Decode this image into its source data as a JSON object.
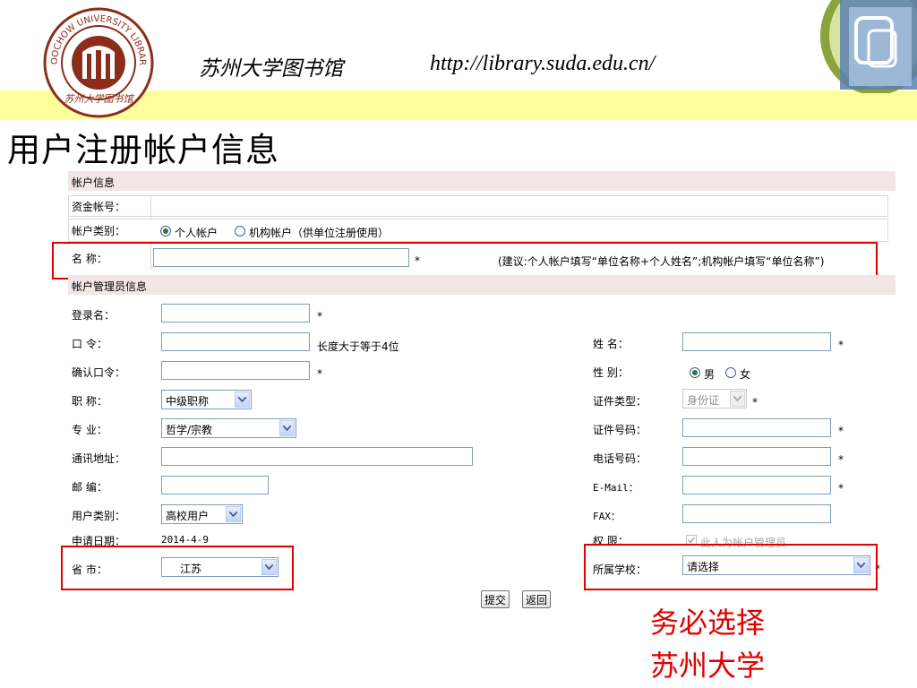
{
  "header": {
    "library_name": "苏州大学图书馆",
    "library_url": "http://library.suda.edu.cn/",
    "logo_text_top": "SOOCHOW UNIVERSITY LIBRARY",
    "logo_text_bottom": "苏州大学图书馆"
  },
  "slide_title": "用户注册帐户信息",
  "account_section": {
    "header": "帐户信息",
    "fund_account_label": "资金帐号：",
    "account_type_label": "帐户类别：",
    "account_type_options": [
      "个人帐户",
      "机构帐户（供单位注册使用）"
    ],
    "account_type_selected": "个人帐户",
    "name_label": "名 称：",
    "name_value": "",
    "name_hint": "(建议:个人帐户填写“单位名称+个人姓名”;机构帐户填写“单位名称”)"
  },
  "admin_section": {
    "header": "帐户管理员信息",
    "login_label": "登录名：",
    "password_label": "口 令：",
    "password_hint": "长度大于等于4位",
    "confirm_label": "确认口令：",
    "title_label": "职 称：",
    "title_value": "中级职称",
    "major_label": "专 业：",
    "major_value": "哲学/宗教",
    "address_label": "通讯地址：",
    "zip_label": "邮 编：",
    "user_type_label": "用户类别：",
    "user_type_value": "高校用户",
    "apply_date_label": "申请日期：",
    "apply_date_value": "2014-4-9",
    "province_label": "省 市：",
    "province_value": "江苏",
    "surname_label": "姓 名：",
    "gender_label": "性 别：",
    "gender_options": [
      "男",
      "女"
    ],
    "gender_selected": "男",
    "id_type_label": "证件类型：",
    "id_type_value": "身份证",
    "id_number_label": "证件号码：",
    "phone_label": "电话号码：",
    "email_label": "E-Mail：",
    "fax_label": "FAX：",
    "permission_label": "权 限：",
    "permission_checkbox": "此人为帐户管理员",
    "school_label": "所属学校：",
    "school_value": "请选择",
    "required_mark": "*"
  },
  "buttons": {
    "submit": "提交",
    "back": "返回"
  },
  "annotation": {
    "line1": "务必选择",
    "line2": "苏州大学"
  },
  "colors": {
    "highlight_red": "#e00000",
    "section_bg": "#f3e6e6",
    "header_band": "#ffff99"
  }
}
